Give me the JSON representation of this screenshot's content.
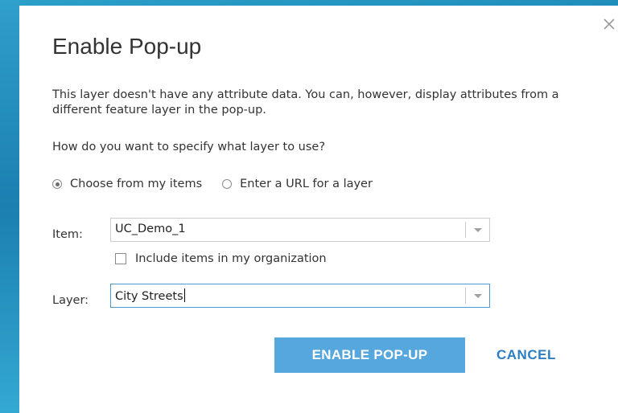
{
  "dialog": {
    "title": "Enable Pop-up",
    "close_icon": "close-icon",
    "description": "This layer doesn't have any attribute data. You can, however, display attributes from a different feature layer in the pop-up.",
    "question": "How do you want to specify what layer to use?",
    "source_options": [
      {
        "label": "Choose from my items",
        "checked": true
      },
      {
        "label": "Enter a URL for a layer",
        "checked": false
      }
    ],
    "item_field": {
      "label": "Item:",
      "value": "UC_Demo_1"
    },
    "include_org": {
      "label": "Include items in my organization",
      "checked": false
    },
    "layer_field": {
      "label": "Layer:",
      "value": "City Streets"
    },
    "buttons": {
      "enable": "ENABLE POP-UP",
      "cancel": "CANCEL"
    }
  },
  "colors": {
    "primary_button": "#56a7de",
    "link": "#2c7ec4",
    "background": "#1e89b8"
  }
}
